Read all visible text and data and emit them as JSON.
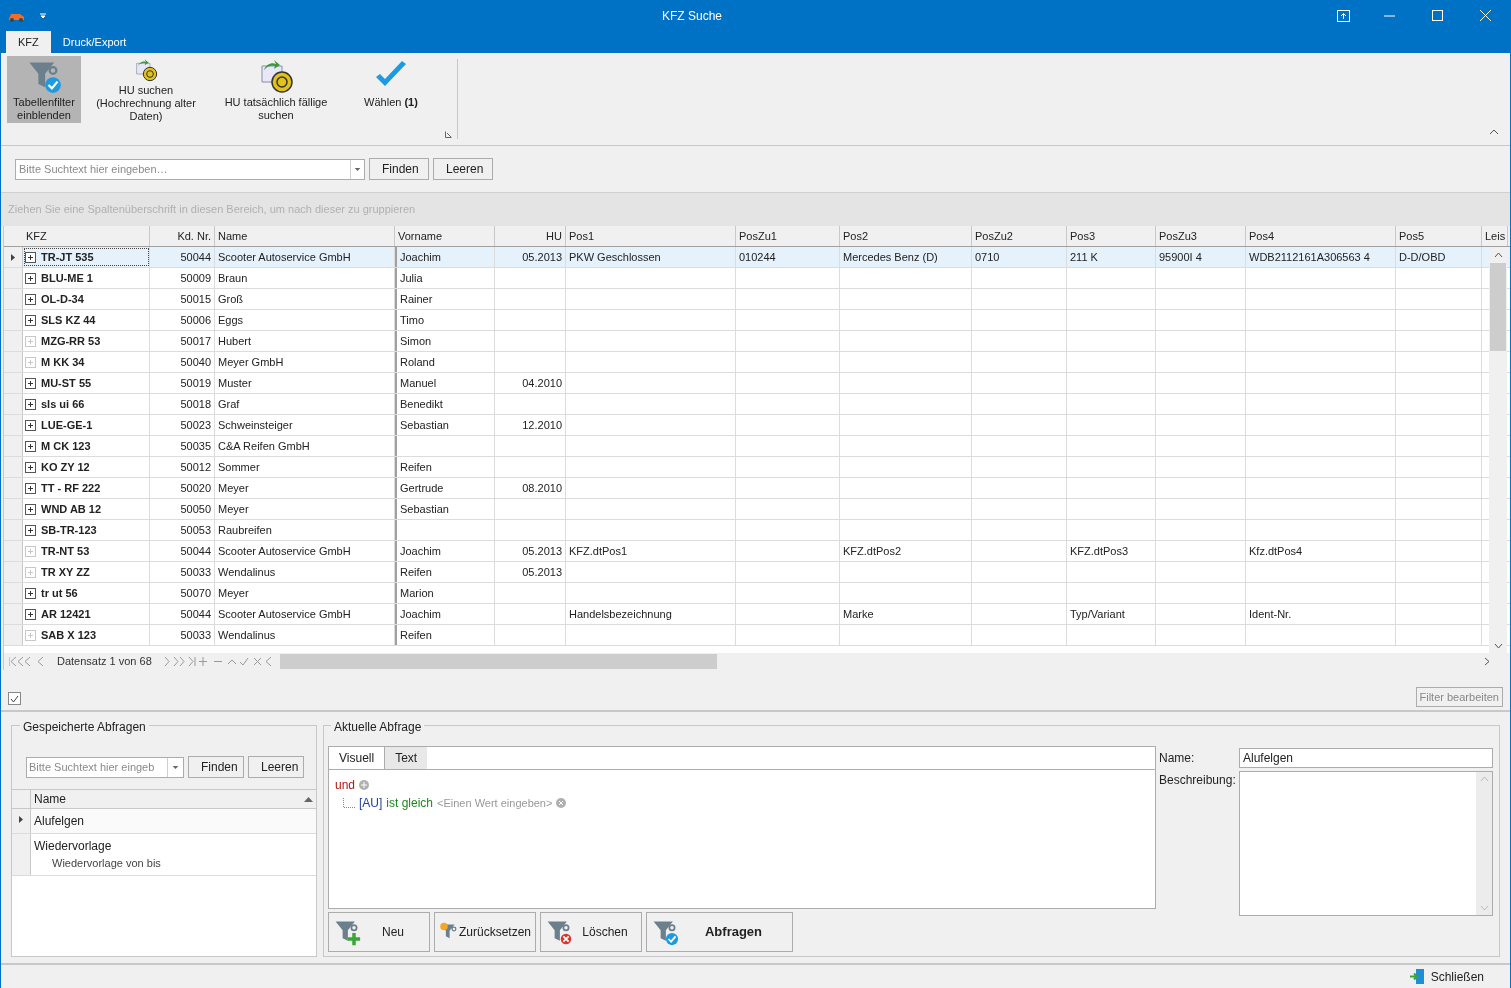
{
  "window": {
    "title": "KFZ Suche"
  },
  "ribbon_tabs": [
    {
      "label": "KFZ",
      "selected": true
    },
    {
      "label": "Druck/Export",
      "selected": false
    }
  ],
  "ribbon_buttons": [
    {
      "kind": "filter",
      "label": "Tabellenfilter einblenden",
      "selected": true
    },
    {
      "kind": "hu",
      "label": "HU suchen (Hochrechnung alter Daten)",
      "selected": false
    },
    {
      "kind": "hu",
      "label": "HU tatsächlich fällige suchen",
      "selected": false
    },
    {
      "kind": "check",
      "label": "Wählen **(1)**",
      "selected": false
    }
  ],
  "search": {
    "placeholder": "Bitte Suchtext hier eingeben…",
    "buttons": [
      "Finden",
      "Leeren"
    ]
  },
  "group_hint": "Ziehen Sie eine Spaltenüberschrift in diesen Bereich, um nach dieser zu gruppieren",
  "grid": {
    "columns": [
      "KFZ",
      "Kd. Nr.",
      "Name",
      "Vorname",
      "HU",
      "Pos1",
      "PosZu1",
      "Pos2",
      "PosZu2",
      "Pos3",
      "PosZu3",
      "Pos4",
      "Pos5",
      "Leis"
    ],
    "rows": [
      {
        "selected": true,
        "expandable": true,
        "cells": [
          "TR-JT 535",
          "50044",
          "Scooter Autoservice GmbH",
          "Joachim",
          "05.2013",
          "PKW Geschlossen",
          "010244",
          "Mercedes Benz (D)",
          "0710",
          "211 K",
          "95900I 4",
          "WDB2112161A306563 4",
          "D-D/OBD"
        ]
      },
      {
        "selected": false,
        "expandable": true,
        "cells": [
          "BLU-ME 1",
          "50009",
          "Braun",
          "Julia",
          "",
          "",
          "",
          "",
          "",
          "",
          "",
          "",
          ""
        ]
      },
      {
        "selected": false,
        "expandable": true,
        "cells": [
          "OL-D-34",
          "50015",
          "Groß",
          "Rainer",
          "",
          "",
          "",
          "",
          "",
          "",
          "",
          "",
          ""
        ]
      },
      {
        "selected": false,
        "expandable": true,
        "cells": [
          "SLS KZ 44",
          "50006",
          "Eggs",
          "Timo",
          "",
          "",
          "",
          "",
          "",
          "",
          "",
          "",
          ""
        ]
      },
      {
        "selected": false,
        "expandable": false,
        "cells": [
          "MZG-RR 53",
          "50017",
          "Hubert",
          "Simon",
          "",
          "",
          "",
          "",
          "",
          "",
          "",
          "",
          ""
        ]
      },
      {
        "selected": false,
        "expandable": false,
        "cells": [
          "M KK 34",
          "50040",
          "Meyer GmbH",
          "Roland",
          "",
          "",
          "",
          "",
          "",
          "",
          "",
          "",
          ""
        ]
      },
      {
        "selected": false,
        "expandable": true,
        "cells": [
          "MU-ST 55",
          "50019",
          "Muster",
          "Manuel",
          "04.2010",
          "",
          "",
          "",
          "",
          "",
          "",
          "",
          ""
        ]
      },
      {
        "selected": false,
        "expandable": true,
        "cells": [
          "sls ui 66",
          "50018",
          "Graf",
          "Benedikt",
          "",
          "",
          "",
          "",
          "",
          "",
          "",
          "",
          ""
        ]
      },
      {
        "selected": false,
        "expandable": true,
        "cells": [
          "LUE-GE-1",
          "50023",
          "Schweinsteiger",
          "Sebastian",
          "12.2010",
          "",
          "",
          "",
          "",
          "",
          "",
          "",
          ""
        ]
      },
      {
        "selected": false,
        "expandable": true,
        "cells": [
          "M CK 123",
          "50035",
          "C&A Reifen GmbH",
          "",
          "",
          "",
          "",
          "",
          "",
          "",
          "",
          "",
          ""
        ]
      },
      {
        "selected": false,
        "expandable": true,
        "cells": [
          "KO ZY 12",
          "50012",
          "Sommer",
          "Reifen",
          "",
          "",
          "",
          "",
          "",
          "",
          "",
          "",
          ""
        ]
      },
      {
        "selected": false,
        "expandable": true,
        "cells": [
          "TT - RF 222",
          "50020",
          "Meyer",
          "Gertrude",
          "08.2010",
          "",
          "",
          "",
          "",
          "",
          "",
          "",
          ""
        ]
      },
      {
        "selected": false,
        "expandable": true,
        "cells": [
          "WND AB 12",
          "50050",
          "Meyer",
          "Sebastian",
          "",
          "",
          "",
          "",
          "",
          "",
          "",
          "",
          ""
        ]
      },
      {
        "selected": false,
        "expandable": true,
        "cells": [
          "SB-TR-123",
          "50053",
          "Raubreifen",
          "",
          "",
          "",
          "",
          "",
          "",
          "",
          "",
          "",
          ""
        ]
      },
      {
        "selected": false,
        "expandable": false,
        "cells": [
          "TR-NT 53",
          "50044",
          "Scooter Autoservice GmbH",
          "Joachim",
          "05.2013",
          "KFZ.dtPos1",
          "",
          "KFZ.dtPos2",
          "",
          "KFZ.dtPos3",
          "",
          "Kfz.dtPos4",
          ""
        ]
      },
      {
        "selected": false,
        "expandable": false,
        "cells": [
          "TR XY ZZ",
          "50033",
          "Wendalinus",
          "Reifen",
          "05.2013",
          "",
          "",
          "",
          "",
          "",
          "",
          "",
          ""
        ]
      },
      {
        "selected": false,
        "expandable": true,
        "cells": [
          "tr ut 56",
          "50070",
          "Meyer",
          "Marion",
          "",
          "",
          "",
          "",
          "",
          "",
          "",
          "",
          ""
        ]
      },
      {
        "selected": false,
        "expandable": true,
        "cells": [
          "AR 12421",
          "50044",
          "Scooter Autoservice GmbH",
          "Joachim",
          "",
          "Handelsbezeichnung",
          "",
          "Marke",
          "",
          "Typ/Variant",
          "",
          "Ident-Nr.",
          ""
        ]
      },
      {
        "selected": false,
        "expandable": false,
        "cells": [
          "SAB X 123",
          "50033",
          "Wendalinus",
          "Reifen",
          "",
          "",
          "",
          "",
          "",
          "",
          "",
          "",
          ""
        ]
      }
    ],
    "record": "Datensatz 1 von 68"
  },
  "filter_bar": {
    "checked": true,
    "button": "Filter bearbeiten"
  },
  "saved_queries": {
    "title": "Gespeicherte Abfragen",
    "placeholder": "Bitte Suchtext hier eingeb",
    "buttons": [
      "Finden",
      "Leeren"
    ],
    "column": "Name",
    "items": [
      {
        "name": "Alufelgen",
        "selected": true
      },
      {
        "name": "Wiedervorlage",
        "description": "Wiedervorlage von bis",
        "selected": false
      }
    ]
  },
  "current_query": {
    "title": "Aktuelle Abfrage",
    "tabs": [
      {
        "label": "Visuell",
        "selected": true
      },
      {
        "label": "Text",
        "selected": false
      }
    ],
    "operator": "und",
    "field": "[AU]",
    "operation": "ist gleich",
    "value_placeholder": "<Einen Wert eingeben>",
    "buttons": [
      {
        "kind": "new",
        "label": "Neu"
      },
      {
        "kind": "reset",
        "label": "Zurücksetzen"
      },
      {
        "kind": "delete",
        "label": "Löschen"
      },
      {
        "kind": "query",
        "label": "Abfragen"
      }
    ],
    "name_label": "Name:",
    "name_value": "Alufelgen",
    "description_label": "Beschreibung:"
  },
  "status_bar": {
    "close": "Schließen"
  }
}
